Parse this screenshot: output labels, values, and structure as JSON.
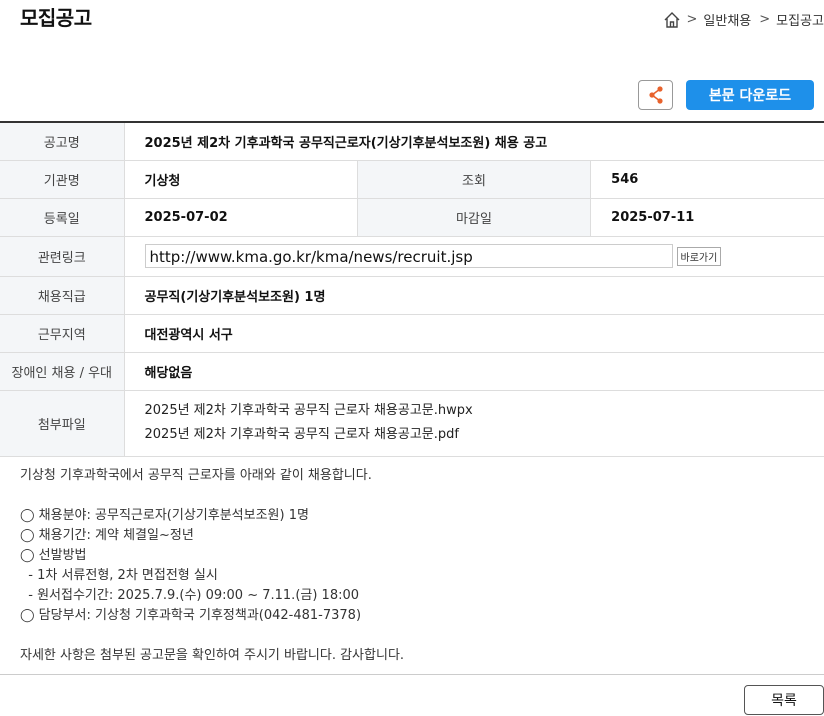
{
  "header": {
    "title": "모집공고",
    "breadcrumb": {
      "separator": ">",
      "items": [
        "일반채용",
        "모집공고"
      ]
    }
  },
  "actions": {
    "share_icon": "share-icon",
    "download_label": "본문 다운로드"
  },
  "info": {
    "title_label": "공고명",
    "title_value": "2025년 제2차 기후과학국 공무직근로자(기상기후분석보조원) 채용 공고",
    "org_label": "기관명",
    "org_value": "기상청",
    "views_label": "조회",
    "views_value": "546",
    "reg_label": "등록일",
    "reg_value": "2025-07-02",
    "deadline_label": "마감일",
    "deadline_value": "2025-07-11",
    "link_label": "관련링크",
    "link_value": "http://www.kma.go.kr/kma/news/recruit.jsp",
    "go_label": "바로가기",
    "position_label": "채용직급",
    "position_value": "공무직(기상기후분석보조원) 1명",
    "location_label": "근무지역",
    "location_value": "대전광역시 서구",
    "disability_label": "장애인 채용 / 우대",
    "disability_value": "해당없음",
    "files_label": "첨부파일",
    "files": [
      "2025년 제2차 기후과학국 공무직 근로자 채용공고문.hwpx",
      "2025년 제2차 기후과학국 공무직 근로자 채용공고문.pdf"
    ]
  },
  "body": {
    "lines": [
      "기상청 기후과학국에서 공무직 근로자를 아래와 같이 채용합니다.",
      "",
      "◯ 채용분야: 공무직근로자(기상기후분석보조원) 1명",
      "◯ 채용기간: 계약 체결일~정년",
      "◯ 선발방법",
      "  - 1차 서류전형, 2차 면접전형 실시",
      "  - 원서접수기간: 2025.7.9.(수) 09:00 ~ 7.11.(금) 18:00",
      "◯ 담당부서: 기상청 기후과학국 기후정책과(042-481-7378)",
      "",
      "자세한 사항은 첨부된 공고문을 확인하여 주시기 바랍니다. 감사합니다."
    ]
  },
  "footer": {
    "list_label": "목록"
  }
}
